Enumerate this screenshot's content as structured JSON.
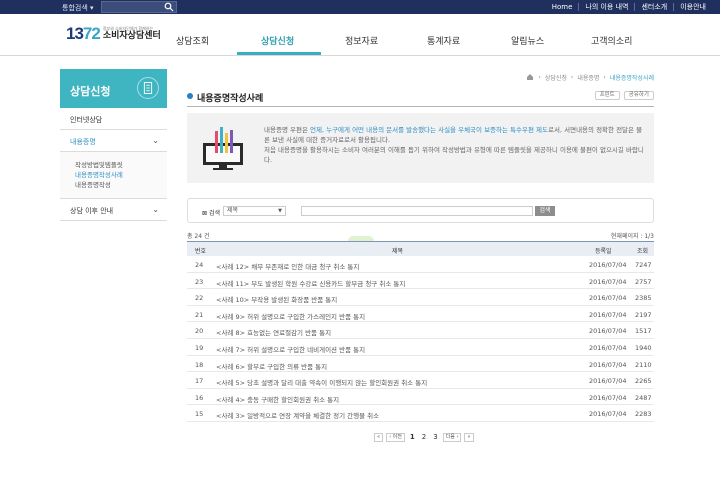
{
  "topbar": {
    "search_label": "통합검색 ▾",
    "links": [
      "Home",
      "나의 이용 내역",
      "센터소개",
      "이용안내"
    ]
  },
  "logo": {
    "number_a": "13",
    "number_b": "72",
    "tagline": "정부와 소비자단체가 함께하는",
    "name": "소비자상담센터"
  },
  "menu": {
    "items": [
      "상담조회",
      "상담신청",
      "정보자료",
      "통계자료",
      "알림뉴스",
      "고객의소리"
    ],
    "active_index": 1
  },
  "lnb": {
    "title": "상담신청",
    "items": [
      {
        "label": "인터넷상담"
      },
      {
        "label": "내용증명"
      }
    ],
    "sub_items": [
      "작성방법및템플릿",
      "내용증명작성사례",
      "내용증명작성"
    ],
    "bottom_item": "상담 이후 안내"
  },
  "breadcrumb": [
    "상담신청",
    "내용증명",
    "내용증명작성사례"
  ],
  "page": {
    "title": "내용증명작성사례",
    "print_label": "프린트",
    "share_label": "공유하기"
  },
  "intro": {
    "p1_a": "내용증명 우편은 ",
    "p1_hl": "언제, 누구에게 어떤 내용의 문서를 발송했다는 사실을 우체국이 보증하는 특수우편 제도",
    "p1_b": "로서, 서면내용의 정확한 전달은 물론 보낸 사실에 대한 증거자료로서 활용됩니다.",
    "p2": "처음 내용증명을 활용하시는 소비자 여러분의 이해를 돕기 위하여 작성방법과 유형에 따른 템플릿을 제공하니 이용에 불편이 없으시길 바랍니다."
  },
  "search": {
    "label": "검색",
    "select_value": "제목",
    "button": "검색"
  },
  "list": {
    "total": "총 24 건",
    "page_info": "현재페이지 : 1/3",
    "headers": {
      "no": "번호",
      "title": "제목",
      "date": "등록일",
      "views": "조회"
    },
    "rows": [
      {
        "no": "24",
        "title": "<사례 12> 채무 부존재로 인한 대금 청구 취소 통지",
        "date": "2016/07/04",
        "views": "7247"
      },
      {
        "no": "23",
        "title": "<사례 11> 부도 발생된 학원 수강료 신용카드 할부금 청구 취소 통지",
        "date": "2016/07/04",
        "views": "2757"
      },
      {
        "no": "22",
        "title": "<사례 10> 부작용 발생된 화장품 반품 통지",
        "date": "2016/07/04",
        "views": "2385"
      },
      {
        "no": "21",
        "title": "<사례 9> 허위 설명으로 구입한 가스레인지 반품 통지",
        "date": "2016/07/04",
        "views": "2197"
      },
      {
        "no": "20",
        "title": "<사례 8> 효능없는 연료절감기 반품 통지",
        "date": "2016/07/04",
        "views": "1517"
      },
      {
        "no": "19",
        "title": "<사례 7> 허위 설명으로 구입한 네비게이션 반품 통지",
        "date": "2016/07/04",
        "views": "1940"
      },
      {
        "no": "18",
        "title": "<사례 6> 할부로 구입한 의류 반품 통지",
        "date": "2016/07/04",
        "views": "2110"
      },
      {
        "no": "17",
        "title": "<사례 5> 당초 설명과 달리 대출 약속이 이행되지 않는 할인회원권 취소 통지",
        "date": "2016/07/04",
        "views": "2265"
      },
      {
        "no": "16",
        "title": "<사례 4> 충동 구매한 할인회원권 취소 통지",
        "date": "2016/07/04",
        "views": "2487"
      },
      {
        "no": "15",
        "title": "<사례 3> 일방적으로 연장 계약을 체결한 정기 간행물 취소",
        "date": "2016/07/04",
        "views": "2283"
      }
    ]
  },
  "pager": {
    "first": "«",
    "prev": "‹ 이전",
    "pages": [
      "1",
      "2",
      "3"
    ],
    "next": "다음 ›",
    "last": "»"
  },
  "colors": {
    "topbar": "#1f2f5e",
    "accent": "#40b5c2",
    "link": "#2f8fc5"
  }
}
